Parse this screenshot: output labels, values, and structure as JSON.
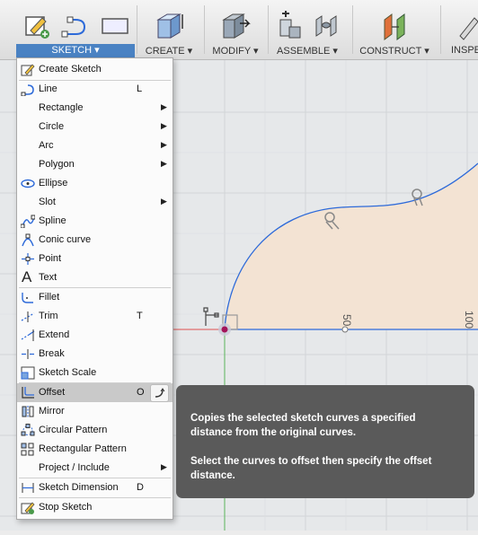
{
  "toolbar": {
    "groups": [
      {
        "label": "SKETCH ▾",
        "active": true
      },
      {
        "label": "CREATE ▾"
      },
      {
        "label": "MODIFY ▾"
      },
      {
        "label": "ASSEMBLE ▾"
      },
      {
        "label": "CONSTRUCT ▾"
      },
      {
        "label": "INSPE"
      }
    ]
  },
  "canvas": {
    "dimension_labels": [
      "50",
      "100"
    ],
    "profile_fill": "#f3e3d3",
    "curve_color": "#2d6ad9",
    "axis_color": "#e05050"
  },
  "menu": {
    "items": [
      {
        "label": "Create Sketch",
        "icon": "create-sketch-icon"
      },
      {
        "label": "Line",
        "shortcut": "L",
        "icon": "line-icon"
      },
      {
        "label": "Rectangle",
        "submenu": true
      },
      {
        "label": "Circle",
        "submenu": true
      },
      {
        "label": "Arc",
        "submenu": true
      },
      {
        "label": "Polygon",
        "submenu": true
      },
      {
        "label": "Ellipse",
        "icon": "ellipse-icon"
      },
      {
        "label": "Slot",
        "submenu": true
      },
      {
        "label": "Spline",
        "icon": "spline-icon"
      },
      {
        "label": "Conic curve",
        "icon": "conic-curve-icon"
      },
      {
        "label": "Point",
        "icon": "point-icon"
      },
      {
        "label": "Text",
        "icon": "text-icon"
      },
      {
        "label": "Fillet",
        "icon": "fillet-icon"
      },
      {
        "label": "Trim",
        "shortcut": "T",
        "icon": "trim-icon"
      },
      {
        "label": "Extend",
        "icon": "extend-icon"
      },
      {
        "label": "Break",
        "icon": "break-icon"
      },
      {
        "label": "Sketch Scale",
        "icon": "sketch-scale-icon"
      },
      {
        "label": "Offset",
        "shortcut": "O",
        "icon": "offset-icon",
        "highlighted": true
      },
      {
        "label": "Mirror",
        "icon": "mirror-icon"
      },
      {
        "label": "Circular Pattern",
        "icon": "circular-pattern-icon"
      },
      {
        "label": "Rectangular Pattern",
        "icon": "rectangular-pattern-icon"
      },
      {
        "label": "Project / Include",
        "submenu": true
      },
      {
        "label": "Sketch Dimension",
        "shortcut": "D",
        "icon": "sketch-dimension-icon"
      },
      {
        "label": "Stop Sketch",
        "icon": "stop-sketch-icon"
      }
    ]
  },
  "tooltip": {
    "line1": "Copies the selected sketch curves a specified distance from the original curves.",
    "line2": "Select the curves to offset then specify the offset distance."
  }
}
